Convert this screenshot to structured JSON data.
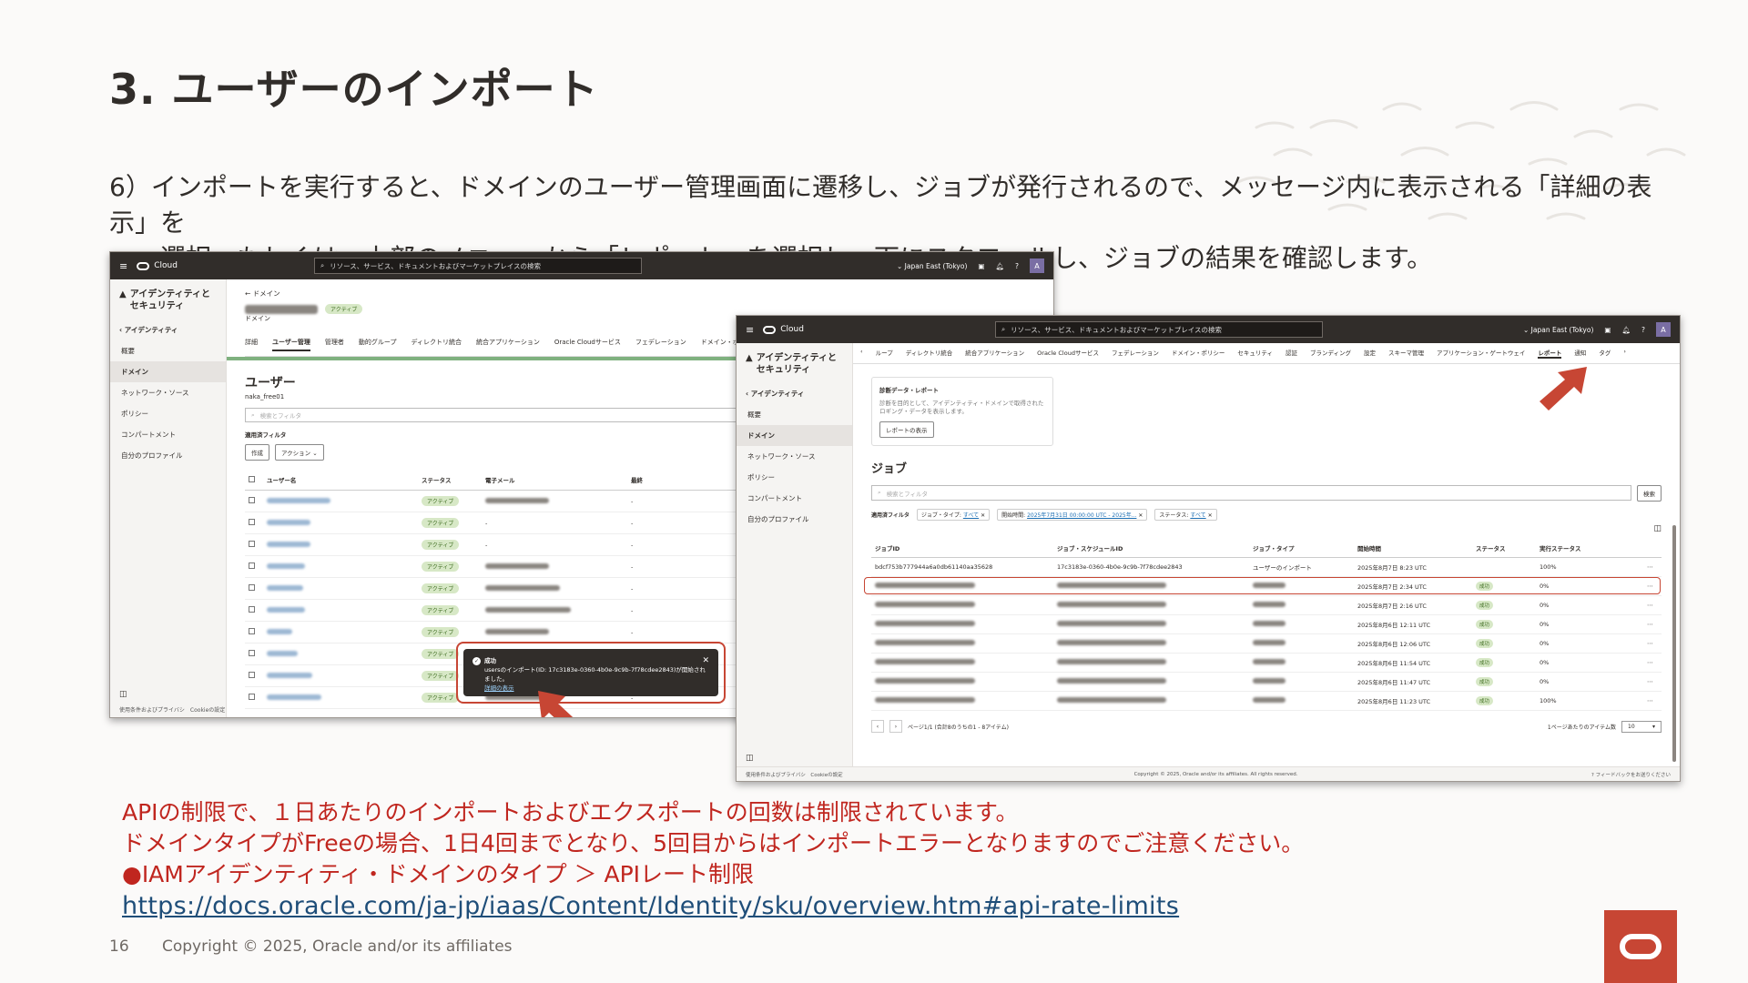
{
  "slide": {
    "title": "3. ユーザーのインポート",
    "step_line1": "6）インポートを実行すると、ドメインのユーザー管理画面に遷移し、ジョブが発行されるので、メッセージ内に表示される「詳細の表示」を",
    "step_line2": "選択、もしくは、上部のメニューから「レポート」を選択し、下にスクロールし、ジョブの結果を確認します。",
    "notes": [
      "APIの制限で、１日あたりのインポートおよびエクスポートの回数は制限されています。",
      "ドメインタイプがFreeの場合、1日4回までとなり、5回目からはインポートエラーとなりますのでご注意ください。",
      "●IAMアイデンティティ・ドメインのタイプ ＞ APIレート制限"
    ],
    "url": "https://docs.oracle.com/ja-jp/iaas/Content/Identity/sku/overview.htm#api-rate-limits",
    "page_number": "16",
    "copyright": "Copyright © 2025, Oracle and/or its affiliates"
  },
  "console": {
    "brand": "Cloud",
    "search_placeholder": "リソース、サービス、ドキュメントおよびマーケットプレイスの検索",
    "region": "Japan East (Tokyo)",
    "avatar": "A",
    "sidebar_title": "アイデンティティとセキュリティ",
    "back_label": "アイデンティティ",
    "nav": [
      "概要",
      "ドメイン",
      "ネットワーク・ソース",
      "ポリシー",
      "コンパートメント",
      "自分のプロファイル"
    ],
    "footer_links": [
      "使用条件およびプライバシ",
      "Cookieの設定"
    ]
  },
  "shot1": {
    "breadcrumb": "← ドメイン",
    "domain_badge": "アクティブ",
    "domain_label": "ドメイン",
    "tabs": [
      "詳細",
      "ユーザー管理",
      "管理者",
      "動的グループ",
      "ディレクトリ統合",
      "統合アプリケーション",
      "Oracle Cloudサービス",
      "フェデレーション",
      "ドメイン・ポリ"
    ],
    "heading": "ユーザー",
    "domain_name": "naka_free01",
    "filter_placeholder": "検索とフィルタ",
    "applied_filters": "適用済フィルタ",
    "create_button": "作成",
    "actions_button": "アクション",
    "columns": [
      "ユーザー名",
      "ステータス",
      "電子メール",
      "最終"
    ],
    "status_value": "アクティブ",
    "toast_title": "成功",
    "toast_message": "usersのインポート(ID: 17c3183e-0360-4b0e-9c9b-7f78cdee2843)が開始されました。",
    "toast_link": "詳細の表示"
  },
  "shot2": {
    "tabs": [
      "ループ",
      "ディレクトリ統合",
      "統合アプリケーション",
      "Oracle Cloudサービス",
      "フェデレーション",
      "ドメイン・ポリシー",
      "セキュリティ",
      "認証",
      "ブランディング",
      "設定",
      "スキーマ管理",
      "アプリケーション・ゲートウェイ",
      "レポート",
      "通知",
      "タグ"
    ],
    "report_card_title": "診断データ・レポート",
    "report_card_desc": "診断を目的として、アイデンティティ・ドメインで取得されたロギング・データを表示します。",
    "report_card_button": "レポートの表示",
    "jobs_heading": "ジョブ",
    "filter_placeholder": "検索とフィルタ",
    "search_button": "検索",
    "applied_filters": "適用済フィルタ",
    "chips": [
      {
        "label": "ジョブ・タイプ:",
        "value": "すべて"
      },
      {
        "label": "開始時間:",
        "value": "2025年7月31日 00:00:00 UTC - 2025年..."
      },
      {
        "label": "ステータス:",
        "value": "すべて"
      }
    ],
    "columns": [
      "ジョブID",
      "ジョブ・スケジュールID",
      "ジョブ・タイプ",
      "開始時間",
      "ステータス",
      "実行ステータス"
    ],
    "highlight_row": {
      "job_id": "bdcf753b777944a6a0db61140aa35628",
      "schedule_id": "17c3183e-0360-4b0e-9c9b-7f78cdee2843",
      "type": "ユーザーのインポート",
      "start": "2025年8月7日 8:23 UTC",
      "progress": "100%"
    },
    "other_rows": [
      {
        "start": "2025年8月7日 2:34 UTC",
        "progress": "0%"
      },
      {
        "start": "2025年8月7日 2:16 UTC",
        "progress": "0%"
      },
      {
        "start": "2025年8月6日 12:11 UTC",
        "progress": "0%"
      },
      {
        "start": "2025年8月6日 12:06 UTC",
        "progress": "0%"
      },
      {
        "start": "2025年8月6日 11:54 UTC",
        "progress": "0%"
      },
      {
        "start": "2025年8月6日 11:47 UTC",
        "progress": "0%"
      },
      {
        "start": "2025年8月6日 11:23 UTC",
        "progress": "100%"
      }
    ],
    "status_value": "成功",
    "pager_text": "ページ1/1 (合計8のうちの1 - 8アイテム)",
    "per_page_label": "1ページあたりのアイテム数",
    "per_page_value": "10",
    "copyright": "Copyright © 2025, Oracle and/or its affiliates. All rights reserved.",
    "feedback": "フィードバックをお送りください"
  },
  "colors": {
    "oracle_red": "#C74634",
    "console_dark": "#312D2A",
    "note_red": "#C0261F",
    "link_blue": "#1F4E79"
  }
}
